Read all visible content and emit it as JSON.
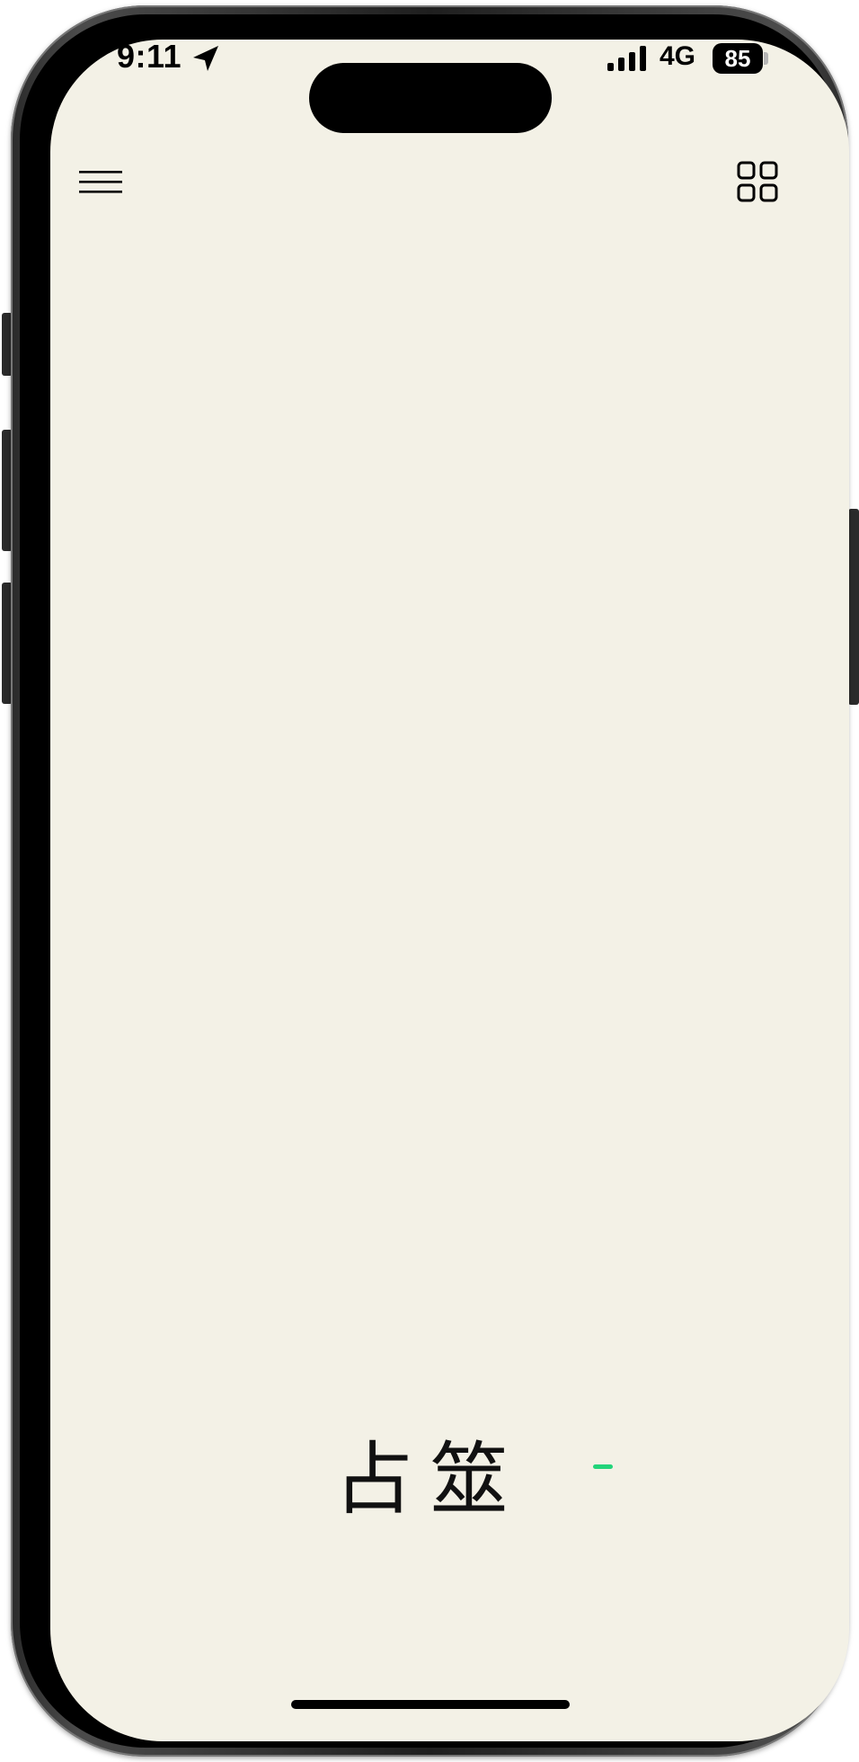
{
  "status_bar": {
    "time": "9:11",
    "location_icon": "location-arrow-icon",
    "signal_icon": "cellular-signal-icon",
    "network": "4G",
    "battery": "85"
  },
  "toolbar": {
    "menu_icon": "hamburger-menu-icon",
    "grid_icon": "grid-view-icon"
  },
  "main": {
    "title": "占筮"
  },
  "colors": {
    "background": "#f3f1e6",
    "accent": "#22d47a",
    "text": "#111111"
  }
}
